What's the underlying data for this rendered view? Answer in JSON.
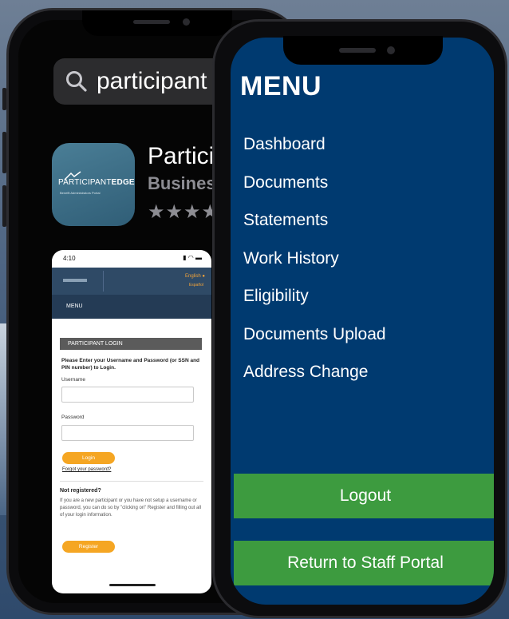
{
  "background_colors": {
    "menu_screen": "#003a70",
    "action_button": "#3d9b3f",
    "login_button": "#f5a623"
  },
  "app_store": {
    "search_query": "participant e",
    "app_name": "Particip",
    "app_category": "Business",
    "stars": "★★★★"
  },
  "app_icon": {
    "logo_main": "PARTICIPANT",
    "logo_bold": "EDGE",
    "logo_sub": "Benefit Administrators Portal"
  },
  "mini_screen": {
    "time": "4:10",
    "status_icons": "▮ ◠ ▬",
    "language": "English ●",
    "language_alt": "Español",
    "menu_label": "MENU",
    "login_header": "PARTICIPANT LOGIN",
    "instructions": "Please Enter your Username and Password (or SSN and PIN number) to Login.",
    "username_label": "Username",
    "password_label": "Password",
    "login_button": "Login",
    "forgot_link": "Forgot your password?",
    "not_registered": "Not registered?",
    "register_text": "If you are a new participant or you have not setup a username or password, you can do so by \"clicking on\" Register and filling out all of your login information.",
    "register_button": "Register"
  },
  "menu": {
    "title": "MENU",
    "items": [
      {
        "label": "Dashboard"
      },
      {
        "label": "Documents"
      },
      {
        "label": "Statements"
      },
      {
        "label": "Work History"
      },
      {
        "label": "Eligibility"
      },
      {
        "label": "Documents Upload"
      },
      {
        "label": "Address Change"
      }
    ],
    "logout_label": "Logout",
    "return_label": "Return to Staff Portal"
  }
}
